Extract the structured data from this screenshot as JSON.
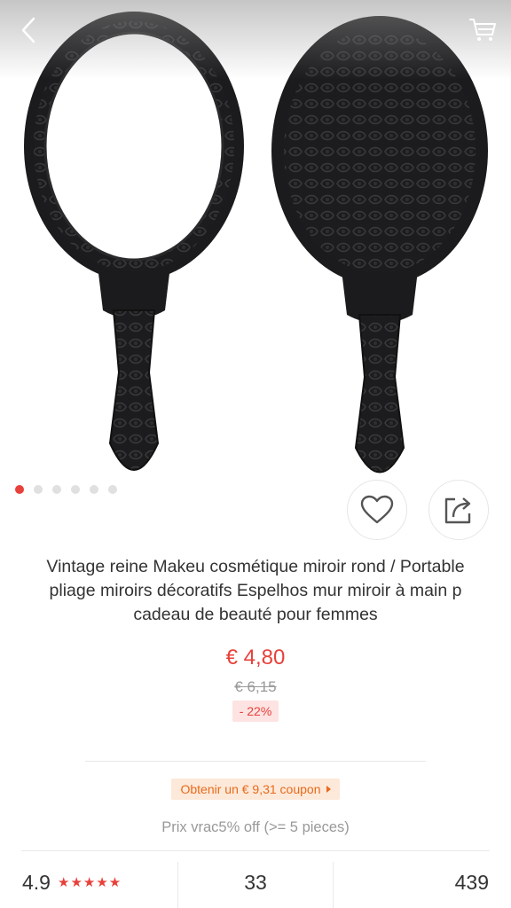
{
  "product": {
    "title": "Vintage reine Makeu cosmétique miroir rond / Portable pliage miroirs décoratifs Espelhos mur miroir à main p cadeau de beauté pour femmes",
    "price": "€ 4,80",
    "old_price": "€ 6,15",
    "discount": "- 22%",
    "coupon": "Obtenir un € 9,31 coupon",
    "bulk_price": "Prix vrac5% off (>= 5 pieces)"
  },
  "gallery": {
    "image_count": 6,
    "active_index": 0
  },
  "stats": {
    "rating": "4.9",
    "stars": 5,
    "reviews": "33",
    "orders": "439"
  },
  "colors": {
    "accent": "#e8403a",
    "coupon": "#e86a1c"
  },
  "icons": {
    "back": "chevron-left-icon",
    "cart": "cart-icon",
    "wishlist": "heart-icon",
    "share": "share-icon"
  }
}
